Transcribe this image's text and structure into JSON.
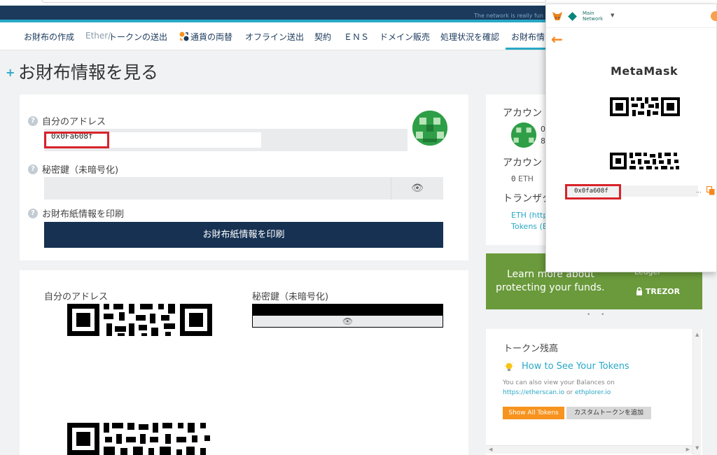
{
  "header": {
    "tagline": "The network is really fun"
  },
  "nav": {
    "items": [
      {
        "label": "お財布の作成",
        "style": "normal"
      },
      {
        "label": "Ether/",
        "style": "muted"
      },
      {
        "label": "トークンの送出",
        "style": "normal"
      },
      {
        "label": "通貨の両替",
        "style": "normal"
      },
      {
        "label": "オフライン送出",
        "style": "normal"
      },
      {
        "label": "契約",
        "style": "normal"
      },
      {
        "label": "ＥＮＳ",
        "style": "normal"
      },
      {
        "label": "ドメイン販売",
        "style": "normal"
      },
      {
        "label": "処理状況を確認",
        "style": "normal"
      },
      {
        "label": "お財布情",
        "style": "active"
      }
    ]
  },
  "page": {
    "title": "お財布情報を見る",
    "plus": "+"
  },
  "wallet": {
    "address_label": "自分のアドレス",
    "address_value": "0x0Fa608f",
    "private_key_label": "秘密鍵（未暗号化)",
    "print_label": "お財布紙情報を印刷",
    "print_button": "お財布紙情報を印刷",
    "help": "?"
  },
  "paper": {
    "address_label": "自分のアドレス",
    "private_key_label": "秘密鍵（未暗号化)"
  },
  "side": {
    "account_label": "アカウン",
    "account_short_1": "0",
    "account_short_2": "8",
    "balance_label": "アカウン",
    "balance_value": "0",
    "balance_unit": "ETH",
    "transactions_label": "トランザク",
    "tx_link_1": "ETH (http",
    "tx_link_2": "Tokens (E"
  },
  "promo": {
    "line1": "Learn more about",
    "line2": "protecting your funds.",
    "ledger": "Ledger",
    "trezor": "TREZOR",
    "dots": "• •"
  },
  "tokens": {
    "title": "トークン残高",
    "how_to": "How to See Your Tokens",
    "desc_line1": "You can also view your Balances on",
    "desc_link1": "https://etherscan.io",
    "desc_or": " or ",
    "desc_link2": "ethplorer.io",
    "show_all": "Show All Tokens",
    "add_custom": "カスタムトークンを追加"
  },
  "metamask": {
    "network_line1": "Main",
    "network_line2": "Network",
    "title": "MetaMask",
    "address": "0x0fa608f",
    "ellipsis": "..."
  },
  "colors": {
    "navy": "#163152",
    "teal": "#28a8c6",
    "highlight_red": "#d8232a",
    "metamask_orange": "#f7861c",
    "promo_green": "#6a9a3b",
    "token_orange": "#f7931e"
  }
}
